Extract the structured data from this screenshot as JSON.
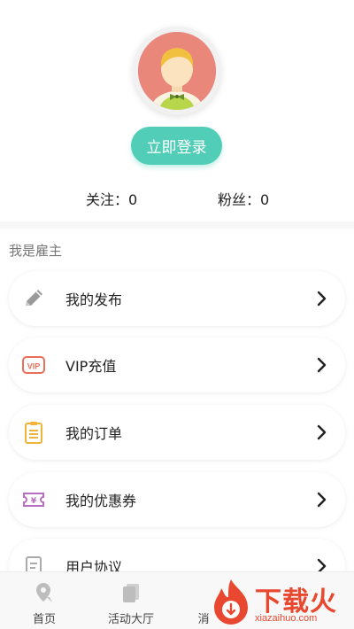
{
  "profile": {
    "login_label": "立即登录",
    "follow_label": "关注：0",
    "fans_label": "粉丝：0"
  },
  "section": {
    "title": "我是雇主"
  },
  "menu": [
    {
      "label": "我的发布",
      "icon": "pencil-icon",
      "color": "#8e8e8e"
    },
    {
      "label": "VIP充值",
      "icon": "vip-icon",
      "color": "#e8705a"
    },
    {
      "label": "我的订单",
      "icon": "clipboard-icon",
      "color": "#f0b43a"
    },
    {
      "label": "我的优惠券",
      "icon": "coupon-icon",
      "color": "#b86fc2"
    },
    {
      "label": "用户协议",
      "icon": "document-icon",
      "color": "#9a9a9a"
    }
  ],
  "tabbar": {
    "tabs": [
      {
        "label": "首页",
        "icon": "location-pin-icon"
      },
      {
        "label": "活动大厅",
        "icon": "cards-icon"
      },
      {
        "label": "消",
        "icon": "message-icon"
      }
    ]
  },
  "watermark": {
    "brand": "下载火",
    "url": "xiazaihuo.com"
  },
  "colors": {
    "accent": "#52cdb7",
    "avatar_bg": "#e8877a",
    "watermark": "#e8482f"
  }
}
